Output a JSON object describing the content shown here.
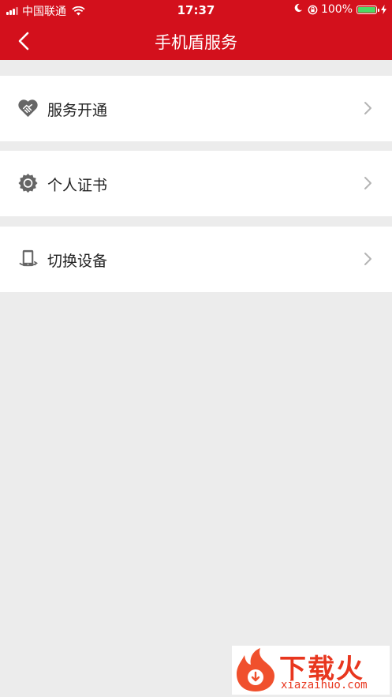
{
  "status_bar": {
    "carrier": "中国联通",
    "time": "17:37",
    "battery_pct": "100%",
    "battery_level": 1.0,
    "battery_color": "#4cd964"
  },
  "nav": {
    "back_icon": "chevron-left-icon",
    "title": "手机盾服务"
  },
  "menu": [
    {
      "label": "服务开通",
      "icon": "handshake-icon"
    },
    {
      "label": "个人证书",
      "icon": "certificate-icon"
    },
    {
      "label": "切换设备",
      "icon": "phone-swap-icon"
    }
  ],
  "watermark": {
    "text_cn": "下载火",
    "text_en": "xiazaihuo.com"
  },
  "colors": {
    "brand_red": "#d3101c",
    "background": "#ececec",
    "watermark": "#e8361e"
  }
}
